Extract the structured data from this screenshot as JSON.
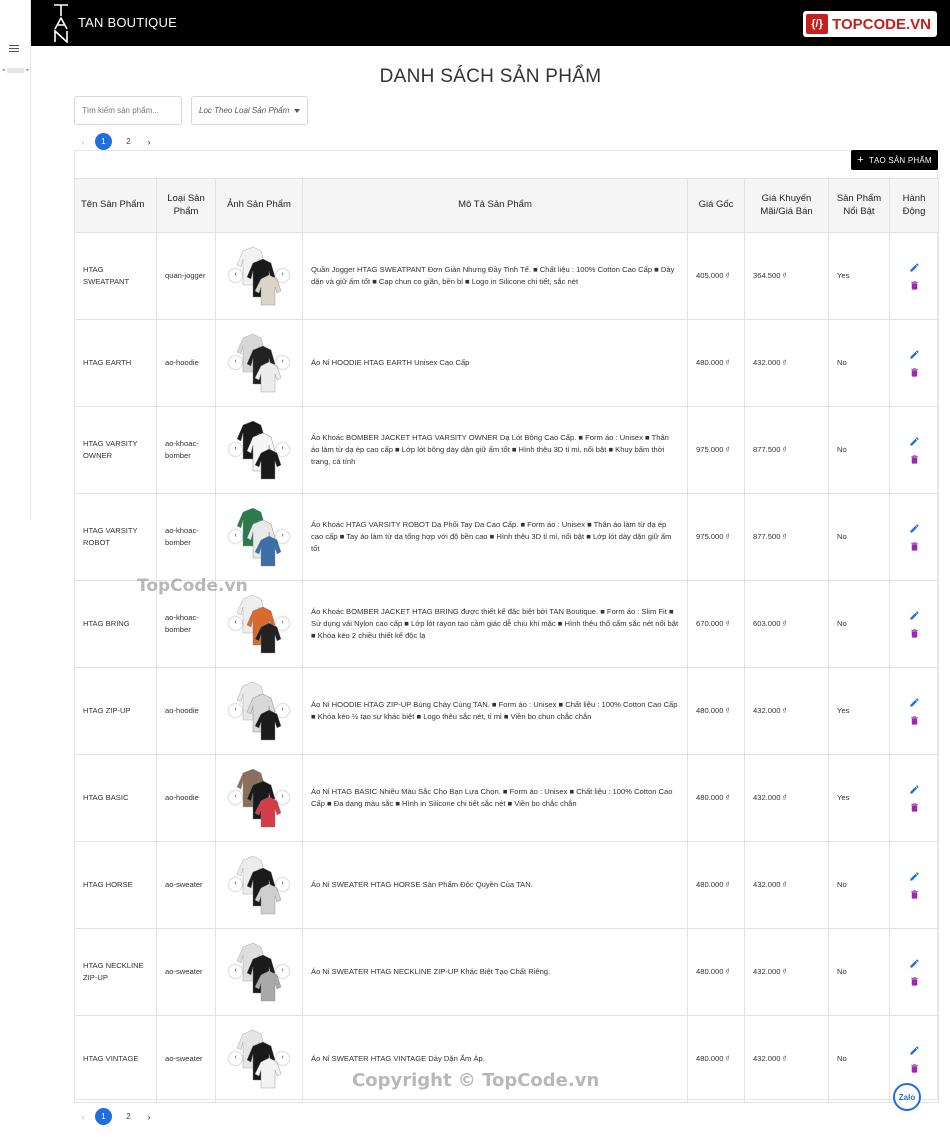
{
  "header": {
    "brand": "TAN BOUTIQUE",
    "logo_text": "TAN",
    "badge_text": "TOPCODE.VN",
    "badge_icon": "{/}"
  },
  "page": {
    "title": "DANH SÁCH SẢN PHẨM"
  },
  "search": {
    "placeholder": "Tìm kiếm sản phẩm..."
  },
  "filter": {
    "label": "Lọc Theo Loại Sản Phẩm"
  },
  "pagination": {
    "pages": [
      "1",
      "2"
    ],
    "current": "1",
    "prev": "‹",
    "next": "›"
  },
  "toolbar": {
    "create_label": "TẠO SẢN PHẨM"
  },
  "table": {
    "headers": {
      "name": "Tên Sản Phẩm",
      "type": "Loại Sản Phẩm",
      "image": "Ảnh Sản Phẩm",
      "desc": "Mô Tả Sản Phẩm",
      "price": "Giá Gốc",
      "sale": "Giá Khuyến Mãi/Giá Bán",
      "featured": "Sản Phẩm Nổi Bật",
      "actions": "Hành Động"
    },
    "rows": [
      {
        "name": "HTAG SWEATPANT",
        "type": "quan-jogger",
        "desc": "Quần Jogger HTAG SWEATPANT Đơn Giản Nhưng Đầy Tinh Tế. ■ Chất liệu : 100% Cotton Cao Cấp ■ Dày dặn và giữ ấm tốt ■ Cạp chun co giãn, bền bỉ ■ Logo in Silicone chi tiết, sắc nét",
        "price": "405.000 ₫",
        "sale": "364.500 ₫",
        "featured": "Yes"
      },
      {
        "name": "HTAG EARTH",
        "type": "ao-hoodie",
        "desc": "Áo Nỉ HOODIE HTAG EARTH Unisex Cao Cấp",
        "price": "480.000 ₫",
        "sale": "432.000 ₫",
        "featured": "No"
      },
      {
        "name": "HTAG VARSITY OWNER",
        "type": "ao-khoac-bomber",
        "desc": "Áo Khoác BOMBER JACKET HTAG VARSITY OWNER Dạ Lót Bông Cao Cấp. ■ Form áo : Unisex ■ Thân áo làm từ dạ ép cao cấp ■ Lớp lót bông dày dặn giữ ấm tốt ■ Hình thêu 3D tỉ mỉ, nổi bật ■ Khuy bấm thời trang, cá tính",
        "price": "975.000 ₫",
        "sale": "877.500 ₫",
        "featured": "No"
      },
      {
        "name": "HTAG VARSITY ROBOT",
        "type": "ao-khoac-bomber",
        "desc": "Áo Khoác HTAG VARSITY ROBOT Dạ Phối Tay Da Cao Cấp. ■ Form áo : Unisex ■ Thân áo làm từ dạ ép cao cấp ■ Tay áo làm từ da tổng hợp với độ bền cao ■ Hình thêu 3D tỉ mỉ, nổi bật ■ Lớp lót dày dặn giữ ấm tốt",
        "price": "975.000 ₫",
        "sale": "877.500 ₫",
        "featured": "No"
      },
      {
        "name": "HTAG BRING",
        "type": "ao-khoac-bomber",
        "desc": "Áo Khoác BOMBER JACKET HTAG BRING được thiết kế đặc biệt bởi TAN Boutique. ■ Form áo : Slim Fit ■ Sử dụng vải Nylon cao cấp ■ Lớp lót rayon tạo cảm giác dễ chịu khi mặc ■ Hình thêu thổ cẩm sắc nét nổi bật ■ Khóa kéo 2 chiều thiết kế độc lạ",
        "price": "670.000 ₫",
        "sale": "603.000 ₫",
        "featured": "No"
      },
      {
        "name": "HTAG ZIP-UP",
        "type": "ao-hoodie",
        "desc": "Áo Nỉ HOODIE HTAG ZIP-UP Bùng Cháy Cùng TAN. ■ Form áo : Unisex ■ Chất liệu : 100% Cotton Cao Cấp ■ Khóa kéo ½ tạo sự khác biệt ■ Logo thêu sắc nét, tỉ mỉ ■ Viền bo chun chắc chắn",
        "price": "480.000 ₫",
        "sale": "432.000 ₫",
        "featured": "Yes"
      },
      {
        "name": "HTAG BASIC",
        "type": "ao-hoodie",
        "desc": "Áo Nỉ HTAG BASIC Nhiều Màu Sắc Cho Bạn Lựa Chọn. ■ Form áo : Unisex ■ Chất liệu : 100% Cotton Cao Cấp ■ Đa dạng màu sắc ■ Hình in Silicone chi tiết sắc nét ■ Viền bo chắc chắn",
        "price": "480.000 ₫",
        "sale": "432.000 ₫",
        "featured": "Yes"
      },
      {
        "name": "HTAG HORSE",
        "type": "ao-sweater",
        "desc": "Áo Nỉ SWEATER HTAG HORSE Sản Phẩm Độc Quyền Của TAN.",
        "price": "480.000 ₫",
        "sale": "432.000 ₫",
        "featured": "No"
      },
      {
        "name": "HTAG NECKLINE ZIP-UP",
        "type": "ao-sweater",
        "desc": "Áo Nỉ SWEATER HTAG NECKLINE ZIP-UP Khác Biệt Tạo Chất Riêng.",
        "price": "480.000 ₫",
        "sale": "432.000 ₫",
        "featured": "No"
      },
      {
        "name": "HTAG VINTAGE",
        "type": "ao-sweater",
        "desc": "Áo Nỉ SWEATER HTAG VINTAGE Dày Dặn Ấm Áp.",
        "price": "480.000 ₫",
        "sale": "432.000 ₫",
        "featured": "No"
      }
    ]
  },
  "thumbs": [
    [
      "#f2f2f2",
      "#1a1a1a",
      "#d9d4c8"
    ],
    [
      "#d8d8d8",
      "#222222",
      "#ececec"
    ],
    [
      "#1a1a1a",
      "#f5f5f5",
      "#1a1a1a"
    ],
    [
      "#2d7a4a",
      "#e9e9e9",
      "#3c6ea8"
    ],
    [
      "#eeeeee",
      "#d9692c",
      "#222222"
    ],
    [
      "#e8e8e8",
      "#d8d8d8",
      "#1b1b1b"
    ],
    [
      "#8b6f5c",
      "#1a1a1a",
      "#d63b4a"
    ],
    [
      "#ececec",
      "#1a1a1a",
      "#cfcfcf"
    ],
    [
      "#dedede",
      "#1a1a1a",
      "#a9a9a9"
    ],
    [
      "#e5e5e5",
      "#1a1a1a",
      "#f3f3f3"
    ]
  ],
  "watermarks": {
    "mid": "TopCode.vn",
    "bottom": "Copyright © TopCode.vn"
  },
  "zalo": {
    "label": "Zalo"
  },
  "colors": {
    "edit": "#1f6fe0",
    "delete": "#9c27b0",
    "accent": "#1f6fe0",
    "badge": "#c5201b"
  }
}
